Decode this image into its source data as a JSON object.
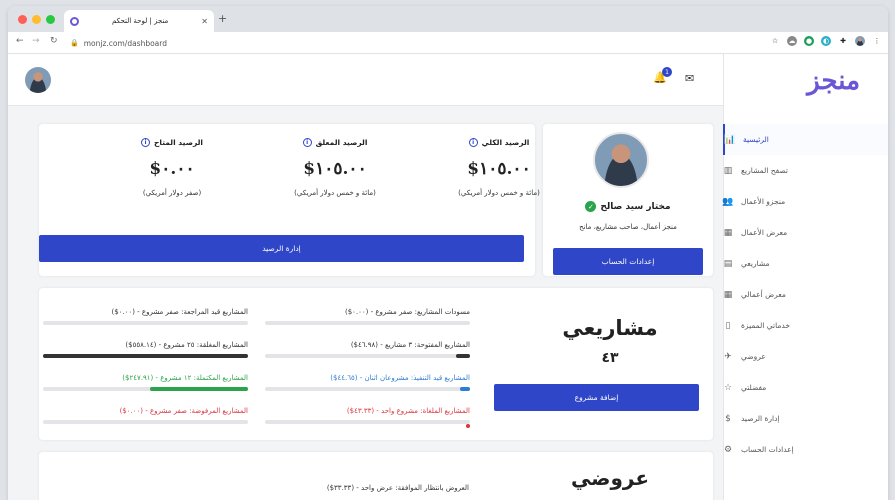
{
  "browser": {
    "tab_title": "منجز | لوحة التحكم",
    "tab_close": "✕",
    "new_tab": "+",
    "url": "monjz.com/dashboard",
    "colors": {
      "red": "#ff5f57",
      "yellow": "#febc2e",
      "green": "#28c840"
    }
  },
  "header": {
    "notification_count": "1",
    "logo_main": "منجز"
  },
  "sidebar": {
    "items": [
      {
        "label": "الرئيسية",
        "icon": "chart-icon",
        "glyph": "📊"
      },
      {
        "label": "تصفح المشاريع",
        "icon": "map-icon",
        "glyph": "▥"
      },
      {
        "label": "منجزو الأعمال",
        "icon": "users-icon",
        "glyph": "👥"
      },
      {
        "label": "معرض الأعمال",
        "icon": "grid-icon",
        "glyph": "▦"
      },
      {
        "label": "مشاريعي",
        "icon": "folder-icon",
        "glyph": "▤"
      },
      {
        "label": "معرض أعمالي",
        "icon": "gallery-icon",
        "glyph": "▦"
      },
      {
        "label": "خدماتي المميزة",
        "icon": "bookmark-icon",
        "glyph": "▯"
      },
      {
        "label": "عروضي",
        "icon": "rocket-icon",
        "glyph": "✈"
      },
      {
        "label": "مفضلتي",
        "icon": "star-icon",
        "glyph": "☆"
      },
      {
        "label": "إدارة الرصيد",
        "icon": "dollar-icon",
        "glyph": "$"
      },
      {
        "label": "إعدادات الحساب",
        "icon": "gear-icon",
        "glyph": "⚙"
      }
    ]
  },
  "profile": {
    "name": "مختار سيد صالح",
    "role": "منجز أعمال، صاحب مشاريع، مانح",
    "settings_button": "إعدادات الحساب"
  },
  "balances": [
    {
      "label": "الرصيد الكلي",
      "amount": "$١٠٥.٠٠",
      "sub": "(مائة و خمس دولار أمريكي)"
    },
    {
      "label": "الرصيد المعلق",
      "amount": "$١٠٥.٠٠",
      "sub": "(مائة و خمس دولار أمريكي)"
    },
    {
      "label": "الرصيد المتاح",
      "amount": "$٠.٠٠",
      "sub": "(صفر دولار أمريكي)"
    }
  ],
  "balance_button": "إدارة الرصيد",
  "projects": {
    "title": "مشاريعي",
    "count": "٤٣",
    "add_button": "إضافة مشروع",
    "stats": [
      {
        "text": "مسودات المشاريع: صفر مشروع - (٠.٠٠$)",
        "color": "#333333",
        "bar_color": "#cccccc",
        "progress": 0
      },
      {
        "text": "المشاريع قيد المراجعة: صفر مشروع - (٠.٠٠$)",
        "color": "#333333",
        "bar_color": "#cccccc",
        "progress": 0
      },
      {
        "text": "المشاريع المفتوحة: ٣ مشاريع - (٤٦.٩٨$)",
        "color": "#333333",
        "bar_color": "#333333",
        "progress": 0.07
      },
      {
        "text": "المشاريع المغلقة: ٢٥ مشروع - (٥٥٨.١٤$)",
        "color": "#333333",
        "bar_color": "#333333",
        "progress": 1.0
      },
      {
        "text": "المشاريع قيد التنفيذ: مشروعان اثنان - (٤٤.٦٥$)",
        "color": "#2d7dd2",
        "bar_color": "#2d7dd2",
        "progress": 0.05
      },
      {
        "text": "المشاريع المكتملة: ١٢ مشروع - (٢٤٧.٩١$)",
        "color": "#2aa34a",
        "bar_color": "#2aa34a",
        "progress": 0.48
      },
      {
        "text": "المشاريع الملغاة: مشروع واحد - (٤٣.٣٣$)",
        "color": "#d9363e",
        "bar_color": "#d9363e",
        "progress": 0.02
      },
      {
        "text": "المشاريع المرفوضة: صفر مشروع - (٠.٠٠$)",
        "color": "#d9363e",
        "bar_color": "#cccccc",
        "progress": 0
      }
    ]
  },
  "offers": {
    "title": "عروضي",
    "stat": "العروض بانتظار الموافقة: عرض واحد - (٣٣.٣٣$)"
  }
}
